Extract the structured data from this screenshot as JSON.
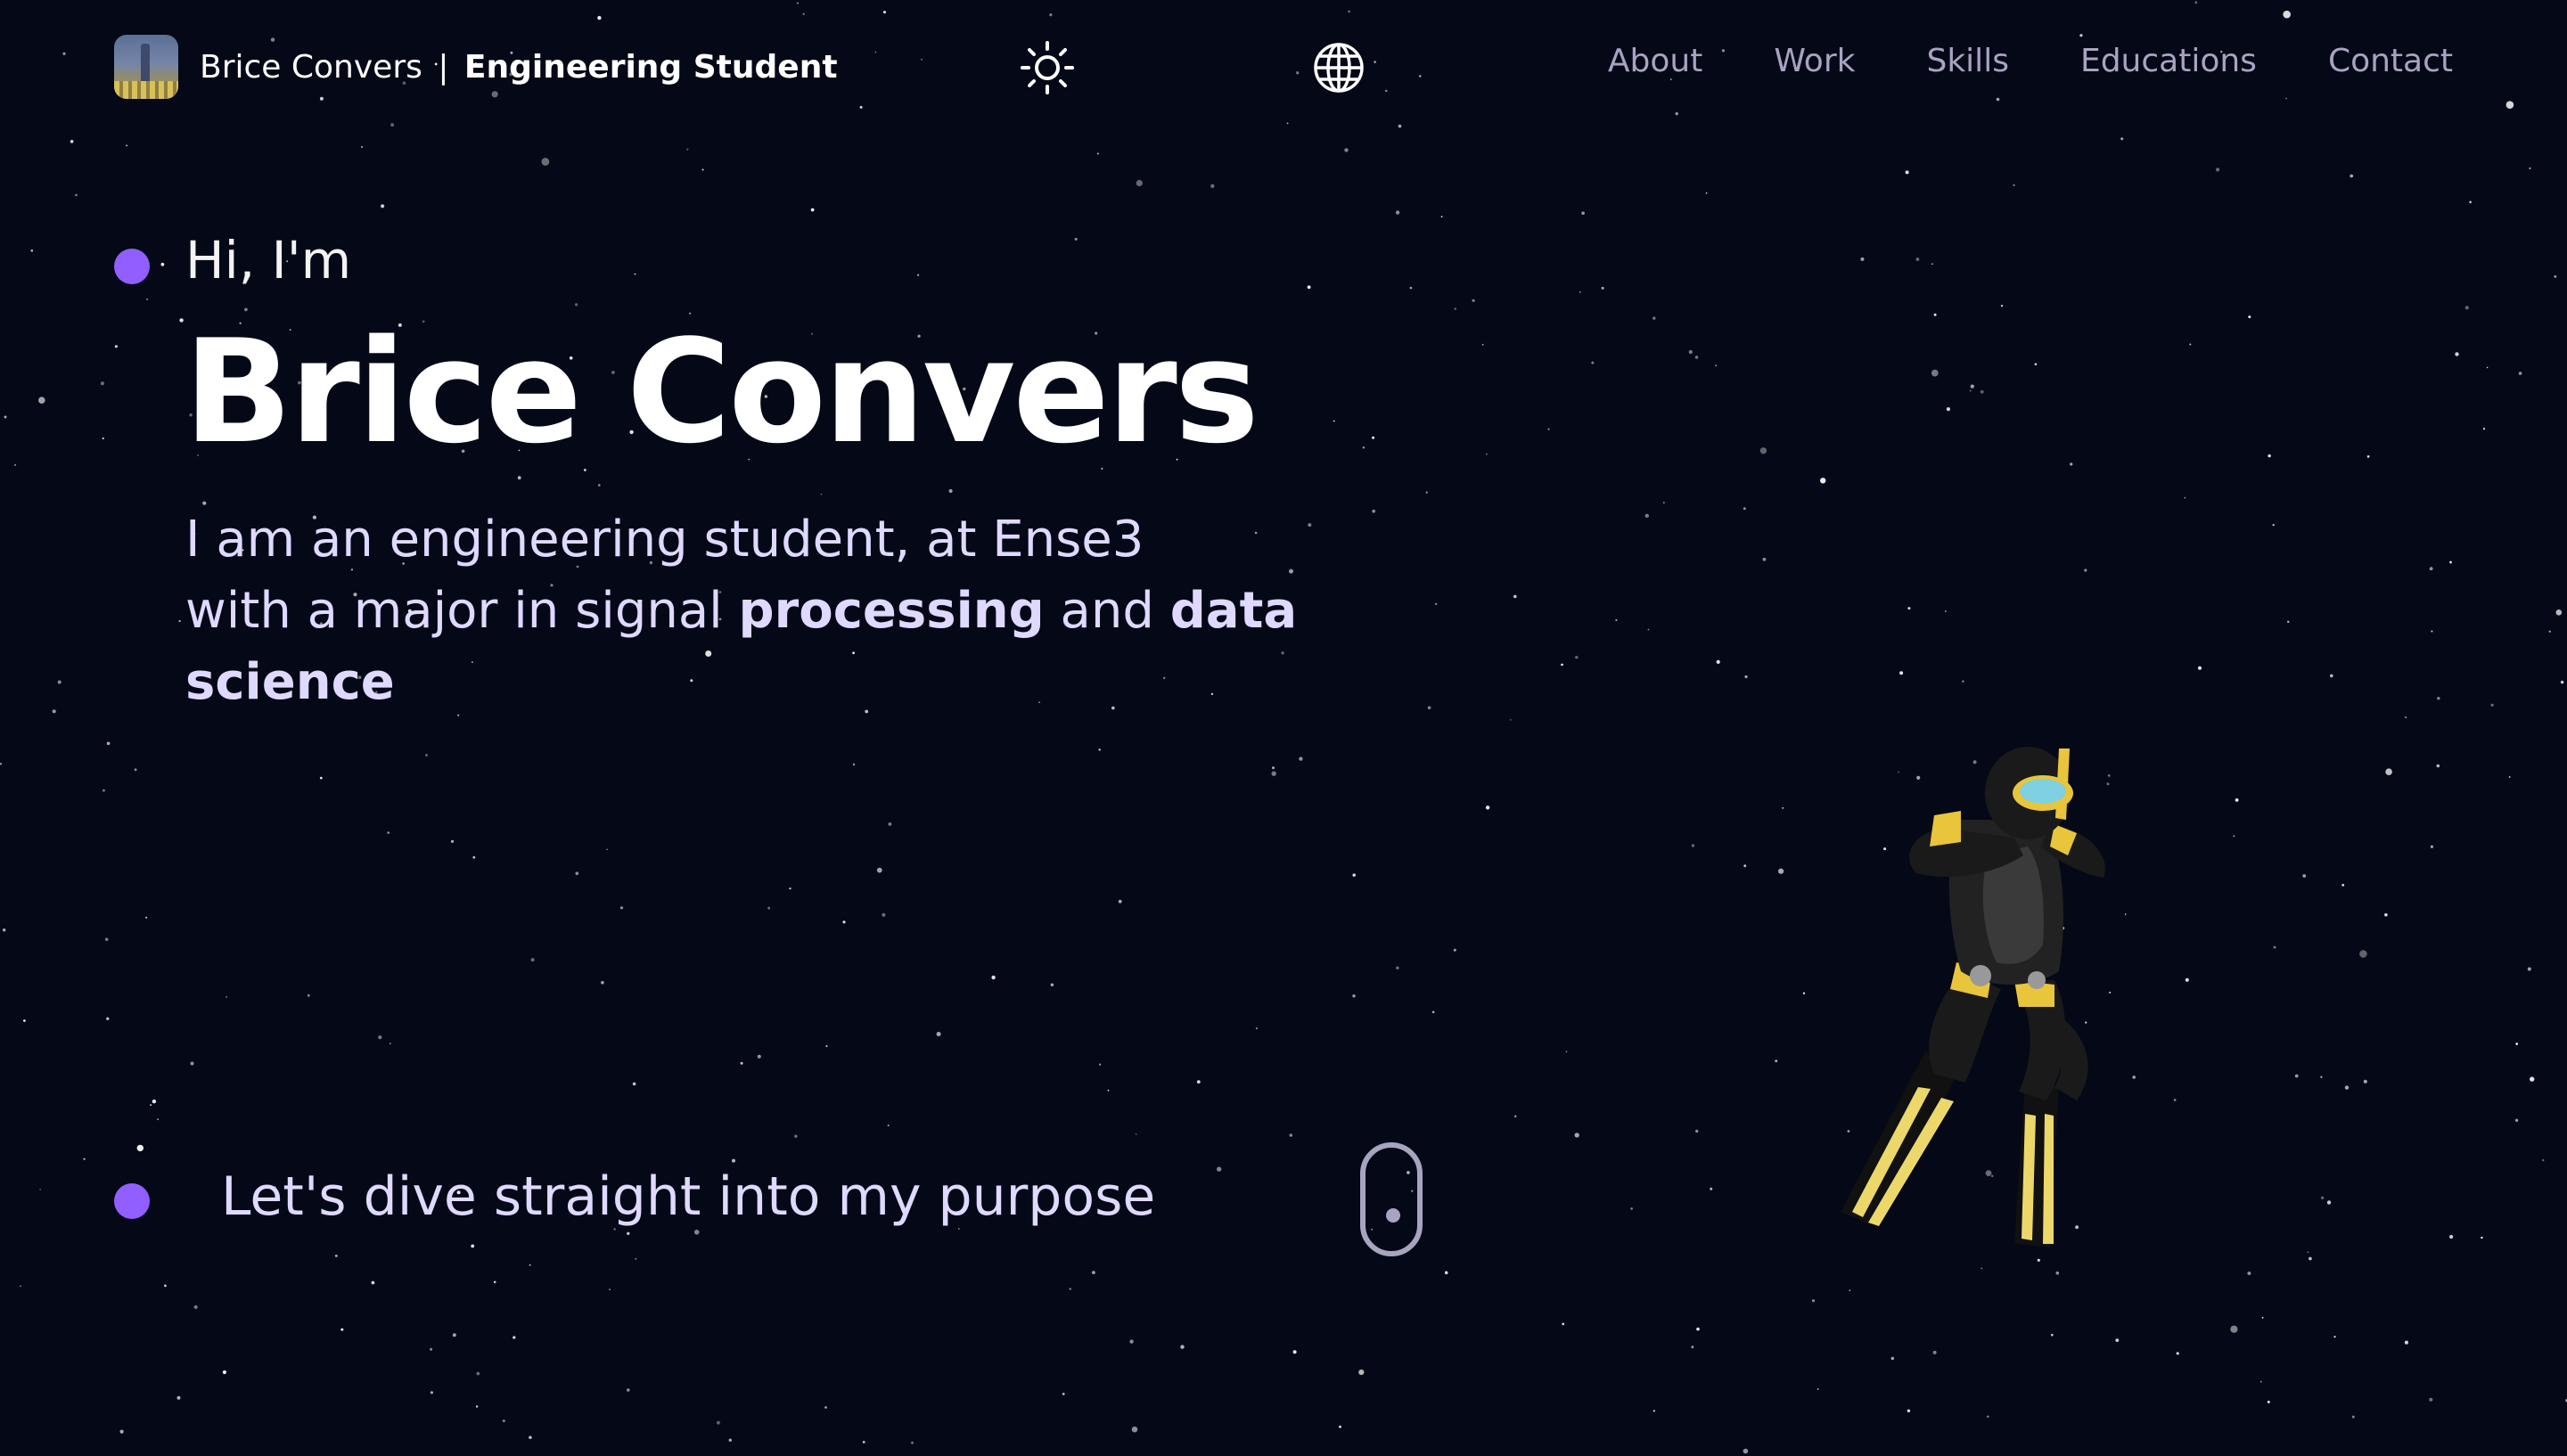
{
  "brand": {
    "name": "Brice Convers",
    "separator": "|",
    "role": "Engineering Student",
    "logo_icon": "profile-photo"
  },
  "header": {
    "theme_icon": "sun-icon",
    "language_icon": "globe-icon"
  },
  "nav": {
    "items": [
      {
        "label": "About"
      },
      {
        "label": "Work"
      },
      {
        "label": "Skills"
      },
      {
        "label": "Educations"
      },
      {
        "label": "Contact"
      }
    ]
  },
  "hero": {
    "greeting": "Hi, I'm",
    "name": "Brice Convers",
    "description": {
      "line1": "I am an engineering student, at Ense3",
      "line2_prefix": "with a major in signal ",
      "line2_bold1": "processing",
      "line2_mid": " and ",
      "line2_bold2": "data",
      "line3_bold": "science"
    },
    "cta": "Let's dive straight into my purpose",
    "scroll_icon": "mouse-scroll-icon",
    "figure": "scuba-diver-3d-model"
  },
  "colors": {
    "background": "#050816",
    "accent": "#915eff",
    "nav_text": "#a9a3c2",
    "hero_text": "#dfd9ff",
    "diver_suit": "#1a1a1a",
    "diver_accent": "#e8c53a"
  }
}
